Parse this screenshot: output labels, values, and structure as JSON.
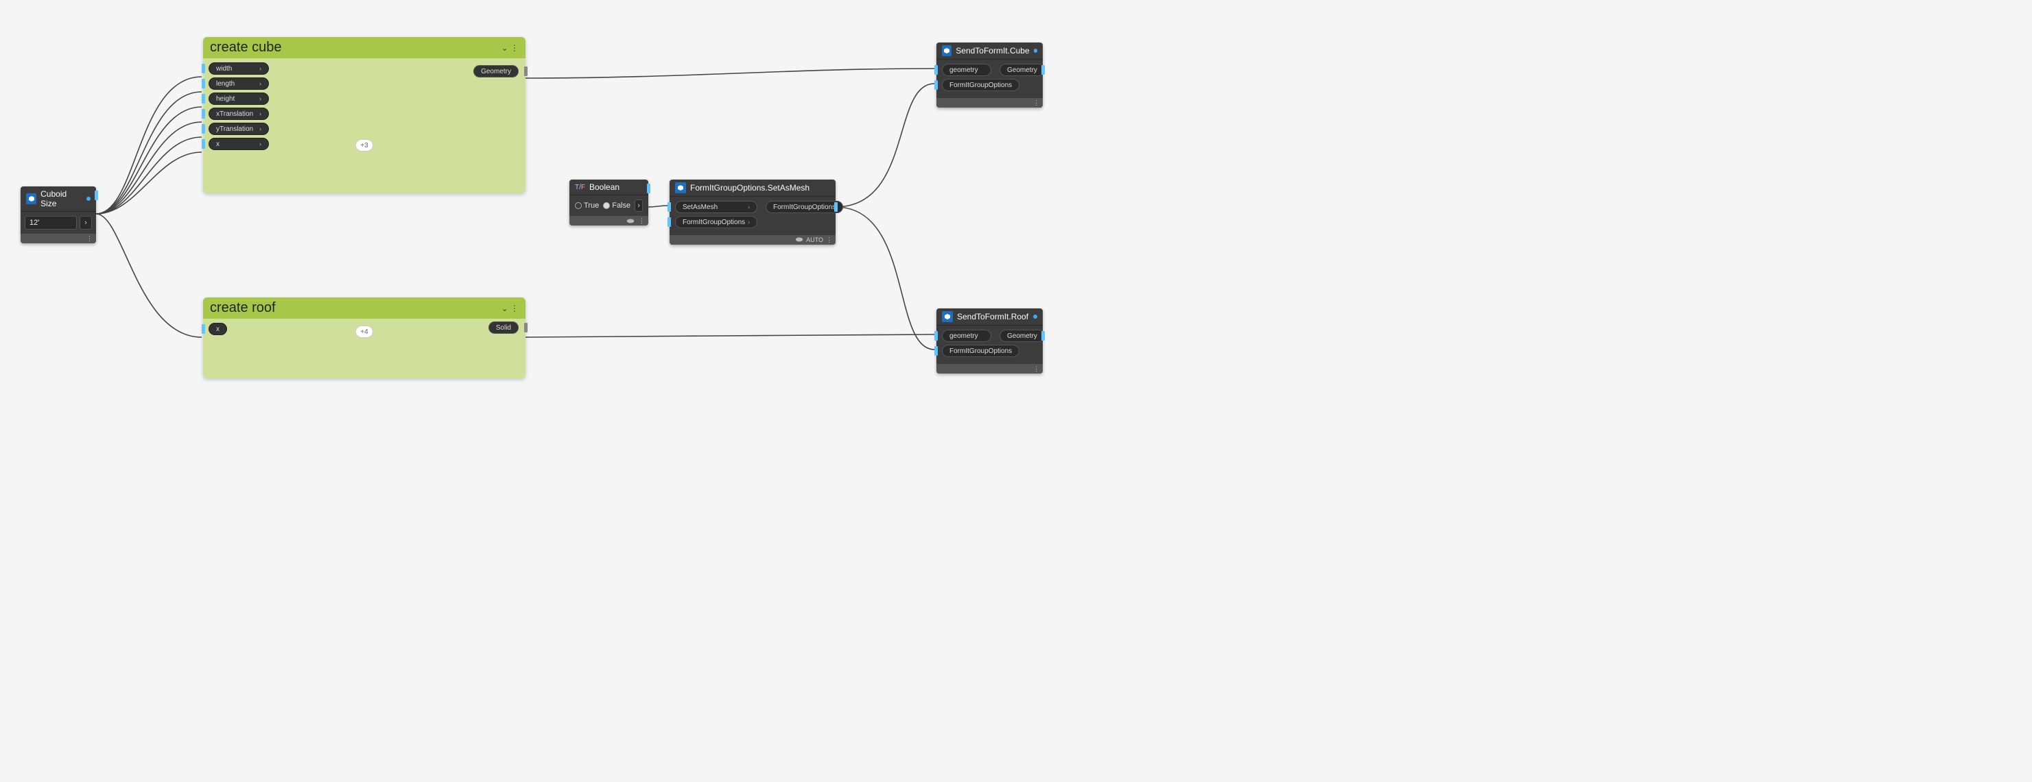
{
  "cuboid": {
    "title": "Cuboid Size",
    "value": "12'"
  },
  "cube_group": {
    "title": "create cube",
    "inputs": [
      "width",
      "length",
      "height",
      "xTranslation",
      "yTranslation",
      "x"
    ],
    "output": "Geometry",
    "extra": "+3"
  },
  "roof_group": {
    "title": "create roof",
    "inputs": [
      "x"
    ],
    "output": "Solid",
    "extra": "+4"
  },
  "boolean": {
    "title": "Boolean",
    "true_label": "True",
    "false_label": "False"
  },
  "mesh": {
    "title": "FormItGroupOptions.SetAsMesh",
    "in1": "SetAsMesh",
    "in2": "FormItGroupOptions",
    "out": "FormItGroupOptions",
    "auto": "AUTO"
  },
  "send_cube": {
    "title": "SendToFormIt.Cube",
    "in1": "geometry",
    "in2": "FormItGroupOptions",
    "out": "Geometry"
  },
  "send_roof": {
    "title": "SendToFormIt.Roof",
    "in1": "geometry",
    "in2": "FormItGroupOptions",
    "out": "Geometry"
  }
}
